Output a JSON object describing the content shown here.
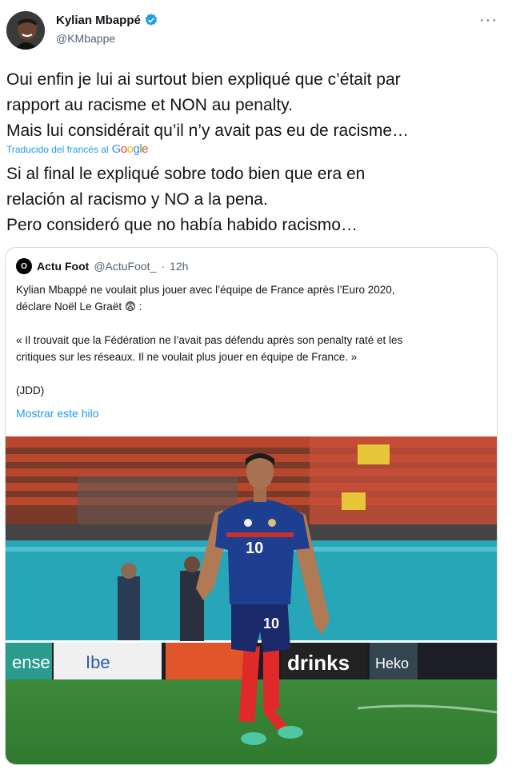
{
  "tweet": {
    "author_name": "Kylian Mbappé",
    "author_handle": "@KMbappe",
    "more_icon": "more-icon",
    "original_text": "Oui enfin je lui ai surtout bien expliqué que c’était par\nrapport au racisme et NON au penalty.\nMais lui considérait qu’il n’y avait pas  eu de racisme…",
    "translated_by": "Traducido del francés al",
    "translated_provider": "Google",
    "translation_text": "Si al final le expliqué sobre todo bien que era en\nrelación al racismo y NO a la pena.\n Pero consideró que no había habido racismo…"
  },
  "quote": {
    "avatar_text": "O",
    "author_name": "Actu Foot",
    "author_handle": "@ActuFoot_",
    "separator": "·",
    "time": "12h",
    "text": "Kylian Mbappé ne voulait plus jouer avec l’équipe de France après l’Euro 2020,\ndéclare Noël Le Graët 😨 :\n\n« Il trouvait que la Fédération ne l’avait pas défendu après son penalty raté et les\ncritiques sur les réseaux. Il ne voulait plus jouer en équipe de France. »\n\n(JDD)",
    "show_thread": "Mostrar este hilo"
  },
  "photo": {
    "shirt_number": "10",
    "board_texts": [
      "ense",
      "Ibe",
      "drinks",
      "Heko"
    ]
  },
  "colors": {
    "accent": "#1d9bf0",
    "text": "#0f1419",
    "muted": "#536471",
    "border": "#cfd9de"
  }
}
